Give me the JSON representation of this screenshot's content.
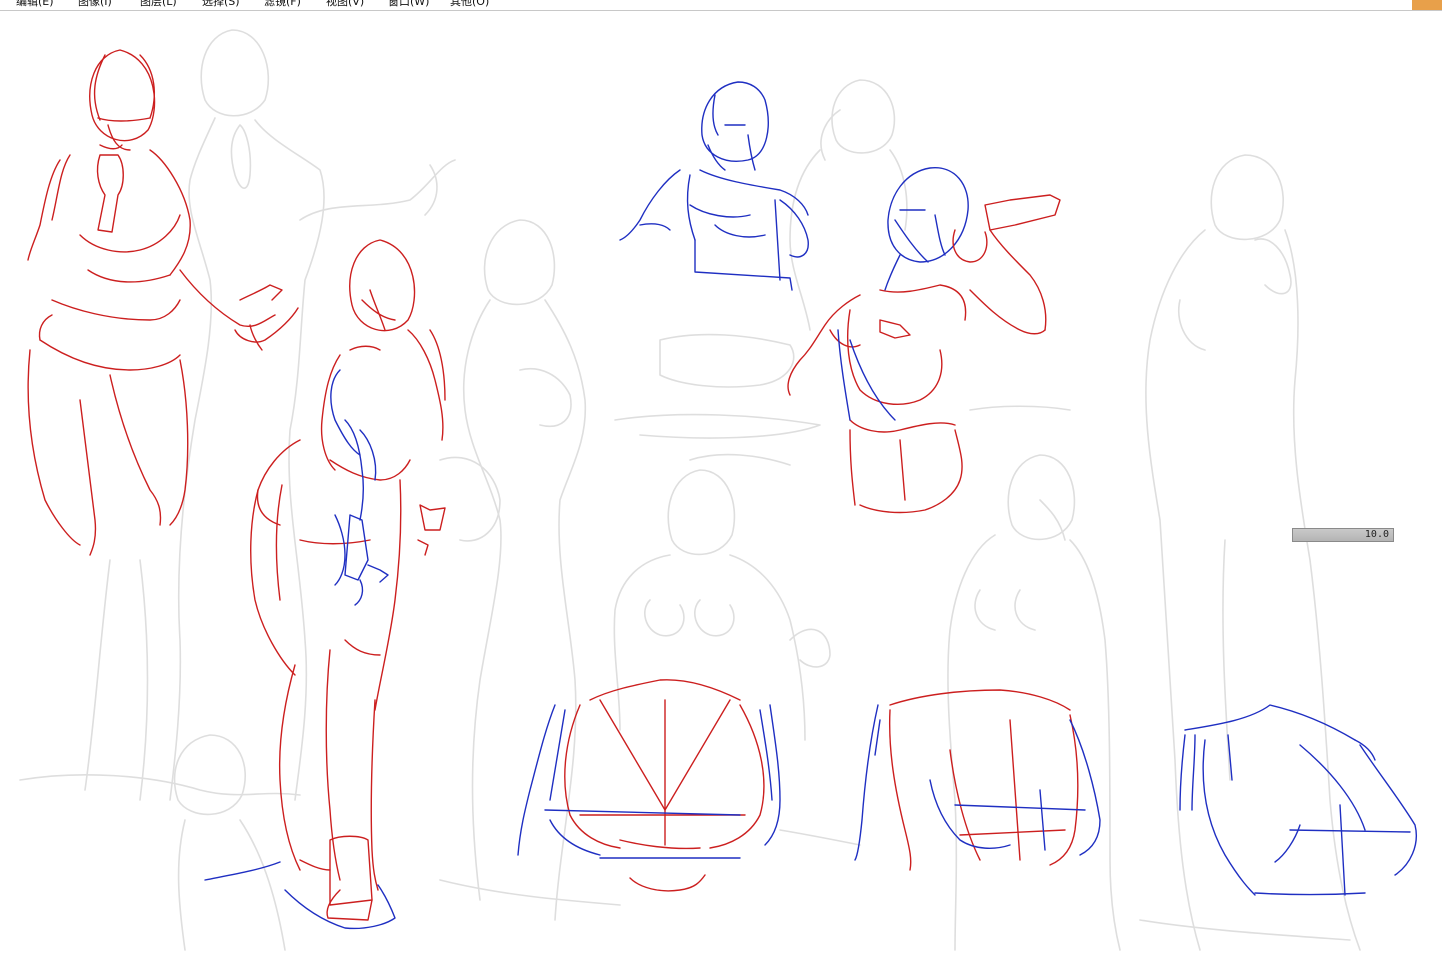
{
  "menubar": {
    "items": [
      {
        "id": "edit",
        "label": "编辑(E)"
      },
      {
        "id": "image",
        "label": "图像(I)"
      },
      {
        "id": "layer",
        "label": "图层(L)"
      },
      {
        "id": "select",
        "label": "选择(S)"
      },
      {
        "id": "filter",
        "label": "滤镜(F)"
      },
      {
        "id": "view",
        "label": "视图(V)"
      },
      {
        "id": "window",
        "label": "窗口(W)"
      },
      {
        "id": "other",
        "label": "其他(O)"
      }
    ],
    "accent_color": "#e8a04a"
  },
  "canvas": {
    "background": "#ffffff",
    "colors": {
      "sketch_gray": "#dedede",
      "red": "#cc1f1f",
      "blue": "#1f2fc2"
    }
  },
  "brush_size": {
    "value": "10.0",
    "fill_fraction": 1.0
  }
}
